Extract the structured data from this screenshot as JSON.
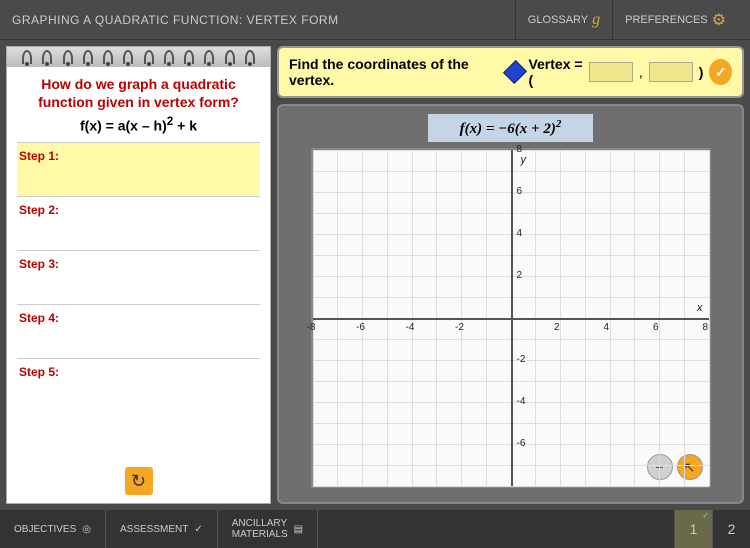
{
  "header": {
    "title": "GRAPHING A QUADRATIC FUNCTION: VERTEX FORM",
    "glossary": "GLOSSARY",
    "preferences": "PREFERENCES"
  },
  "notepad": {
    "question": "How do we graph a quadratic function given in vertex form?",
    "equation_lead": "f(x) = a(x – h)",
    "equation_exp": "2",
    "equation_tail": " + k",
    "steps": [
      "Step 1:",
      "Step 2:",
      "Step 3:",
      "Step 4:",
      "Step 5:"
    ]
  },
  "prompt": {
    "instruction": "Find the coordinates of the vertex.",
    "vertex_label": "Vertex = (",
    "comma": ",",
    "close": ")"
  },
  "equation": {
    "lead": "f(x) = −6(x + 2)",
    "exp": "2"
  },
  "chart_data": {
    "type": "grid",
    "xlim": [
      -8,
      8
    ],
    "ylim": [
      -8,
      8
    ],
    "xticks": [
      -8,
      -6,
      -4,
      -2,
      2,
      4,
      6,
      8
    ],
    "yticks": [
      -6,
      -4,
      -2,
      2,
      4,
      6,
      8
    ],
    "xlabel": "x",
    "ylabel": "y"
  },
  "bottom": {
    "objectives": "OBJECTIVES",
    "assessment": "ASSESSMENT",
    "ancillary": "ANCILLARY\nMATERIALS",
    "page_current": "1",
    "page_other": "2"
  }
}
